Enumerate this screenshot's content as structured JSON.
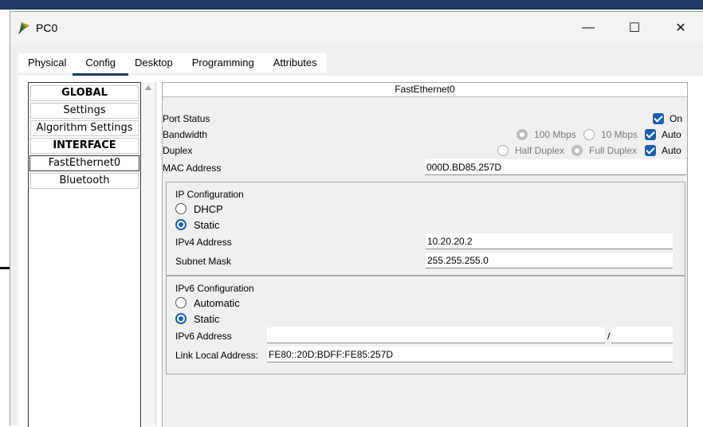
{
  "window": {
    "title": "PC0",
    "minimize": "—",
    "maximize": "☐",
    "close": "✕"
  },
  "tabs": [
    "Physical",
    "Config",
    "Desktop",
    "Programming",
    "Attributes"
  ],
  "active_tab": "Config",
  "sidebar": {
    "items": [
      {
        "label": "GLOBAL",
        "type": "header"
      },
      {
        "label": "Settings",
        "type": "item"
      },
      {
        "label": "Algorithm Settings",
        "type": "item"
      },
      {
        "label": "INTERFACE",
        "type": "header"
      },
      {
        "label": "FastEthernet0",
        "type": "selected"
      },
      {
        "label": "Bluetooth",
        "type": "item"
      }
    ]
  },
  "panel": {
    "title": "FastEthernet0",
    "port_status": {
      "label": "Port Status",
      "on_label": "On",
      "on_checked": true
    },
    "bandwidth": {
      "label": "Bandwidth",
      "opt_100": "100 Mbps",
      "opt_10": "10 Mbps",
      "auto": "Auto",
      "auto_checked": true
    },
    "duplex": {
      "label": "Duplex",
      "half": "Half Duplex",
      "full": "Full Duplex",
      "auto": "Auto",
      "auto_checked": true
    },
    "mac": {
      "label": "MAC Address",
      "value": "000D.BD85.257D"
    },
    "ip_config": {
      "title": "IP Configuration",
      "dhcp": "DHCP",
      "static": "Static",
      "selected": "Static",
      "ipv4_label": "IPv4 Address",
      "ipv4_value": "10.20.20.2",
      "mask_label": "Subnet Mask",
      "mask_value": "255.255.255.0"
    },
    "ipv6_config": {
      "title": "IPv6 Configuration",
      "automatic": "Automatic",
      "static": "Static",
      "selected": "Static",
      "ipv6_label": "IPv6 Address",
      "ipv6_value": "",
      "prefix_sep": "/",
      "prefix_value": "",
      "link_local_label": "Link Local Address:",
      "link_local_value": "FE80::20D:BDFF:FE85:257D"
    }
  },
  "colors": {
    "accent": "#1a5fb4",
    "title_bar_bg": "#1f3a63"
  }
}
